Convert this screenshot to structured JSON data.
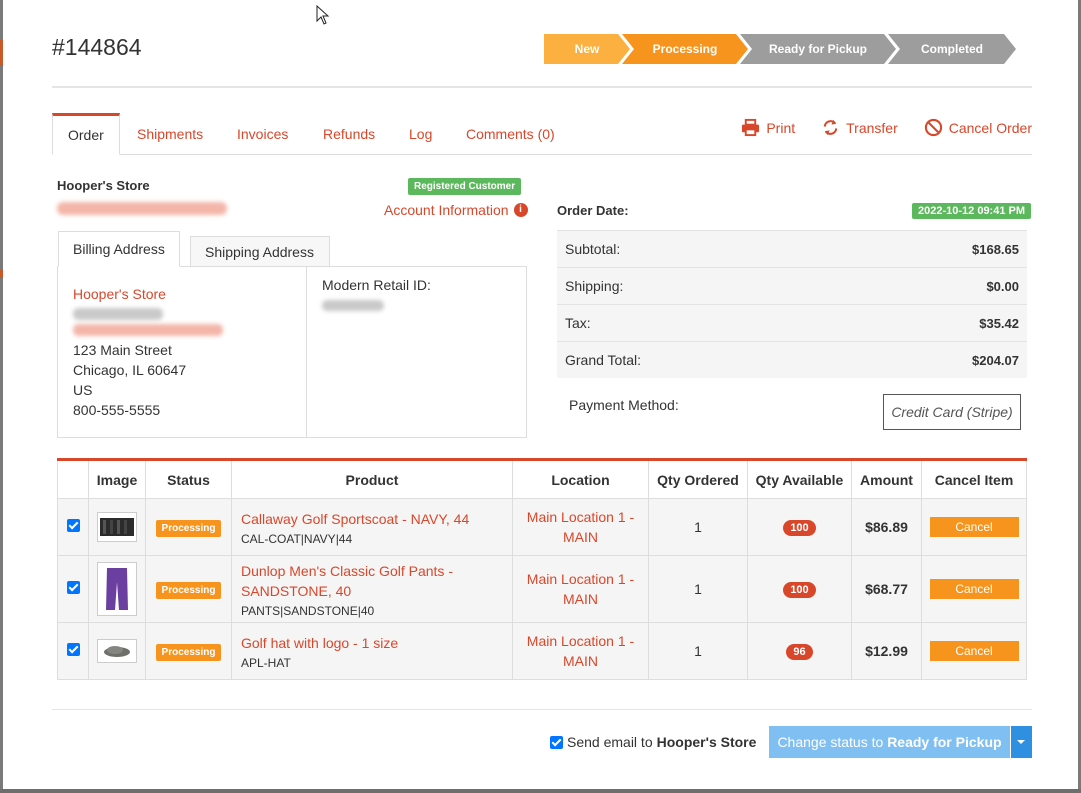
{
  "order": {
    "number": "#144864"
  },
  "progress": {
    "steps": [
      "New",
      "Processing",
      "Ready for Pickup",
      "Completed"
    ],
    "current": "Processing"
  },
  "tabs": [
    "Order",
    "Shipments",
    "Invoices",
    "Refunds",
    "Log",
    "Comments (0)"
  ],
  "actions": {
    "print": "Print",
    "transfer": "Transfer",
    "cancel_order": "Cancel Order"
  },
  "customer": {
    "store_name": "Hooper's Store",
    "badge": "Registered Customer",
    "account_info": "Account Information",
    "info_glyph": "i"
  },
  "address": {
    "tabs": [
      "Billing Address",
      "Shipping Address"
    ],
    "name": "Hooper's Store",
    "street": "123 Main Street",
    "city_line": "Chicago, IL 60647",
    "country": "US",
    "phone": "800-555-5555",
    "modern_retail_label": "Modern Retail ID:"
  },
  "summary": {
    "order_date_label": "Order Date:",
    "order_date": "2022-10-12 09:41 PM",
    "rows": [
      {
        "label": "Subtotal:",
        "value": "$168.65"
      },
      {
        "label": "Shipping:",
        "value": "$0.00"
      },
      {
        "label": "Tax:",
        "value": "$35.42"
      },
      {
        "label": "Grand Total:",
        "value": "$204.07"
      }
    ],
    "payment_label": "Payment Method:",
    "payment_method": "Credit Card (Stripe)"
  },
  "items_table": {
    "headers": [
      "",
      "Image",
      "Status",
      "Product",
      "Location",
      "Qty Ordered",
      "Qty Available",
      "Amount",
      "Cancel Item"
    ],
    "rows": [
      {
        "status": "Processing",
        "name": "Callaway Golf Sportscoat - NAVY, 44",
        "sku": "CAL-COAT|NAVY|44",
        "location": "Main Location 1 - MAIN",
        "qty_ordered": "1",
        "qty_available": "100",
        "amount": "$86.89",
        "cancel": "Cancel"
      },
      {
        "status": "Processing",
        "name": "Dunlop Men's Classic Golf Pants - SANDSTONE, 40",
        "sku": "PANTS|SANDSTONE|40",
        "location": "Main Location 1 - MAIN",
        "qty_ordered": "1",
        "qty_available": "100",
        "amount": "$68.77",
        "cancel": "Cancel"
      },
      {
        "status": "Processing",
        "name": "Golf hat with logo - 1 size",
        "sku": "APL-HAT",
        "location": "Main Location 1 - MAIN",
        "qty_ordered": "1",
        "qty_available": "96",
        "amount": "$12.99",
        "cancel": "Cancel"
      }
    ]
  },
  "footer": {
    "send_email_prefix": "Send email to",
    "send_email_target": "Hooper's Store",
    "change_status_prefix": "Change status to",
    "change_status_target": "Ready for Pickup"
  },
  "colors": {
    "accent": "#d9472b",
    "orange": "#f7941d",
    "green": "#5cb85c",
    "primary_button": "#7fbff2"
  }
}
